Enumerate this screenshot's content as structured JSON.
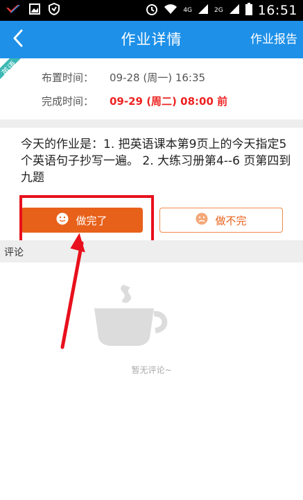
{
  "status_bar": {
    "time": "16:51",
    "network_label_1": "4G",
    "network_label_2": "2G"
  },
  "header": {
    "title": "作业详情",
    "report_label": "作业报告"
  },
  "info": {
    "subject_tag": "英语",
    "assign_label": "布置时间：",
    "assign_value": "09-28 (周一) 16:35",
    "due_label": "完成时间：",
    "due_value": "09-29 (周二) 08:00 前"
  },
  "homework": {
    "content": "今天的作业是：1. 把英语课本第9页上的今天指定5个英语句子抄写一遍。        2. 大练习册第4--6 页第四到九题"
  },
  "actions": {
    "done_label": "做完了",
    "not_done_label": "做不完"
  },
  "comments": {
    "header": "评论",
    "empty_text": "暂无评论~"
  },
  "colors": {
    "title_bar": "#1e90e8",
    "accent_orange": "#e8611a",
    "deadline_red": "#ee2222",
    "ribbon_teal": "#3cb8b4",
    "annotation_red": "#e8101c"
  }
}
